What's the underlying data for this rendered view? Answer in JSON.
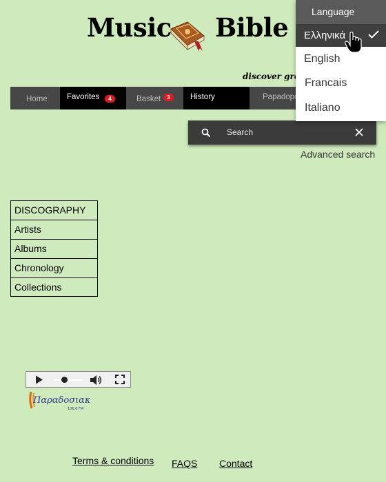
{
  "header": {
    "title_word1": "Music",
    "title_word2": "Bible",
    "tagline": "discover greek music"
  },
  "navbar": {
    "items": [
      {
        "label": "Home"
      },
      {
        "label": "Favorites",
        "badge": "4"
      },
      {
        "label": "Basket",
        "badge": "3"
      },
      {
        "label": "History"
      },
      {
        "label": "Papadopoulos"
      }
    ]
  },
  "search": {
    "placeholder": "Search",
    "advanced_label": "Advanced search"
  },
  "categories": {
    "items": [
      {
        "label": "DISCOGRAPHY"
      },
      {
        "label": "Artists"
      },
      {
        "label": "Albums"
      },
      {
        "label": "Chronology"
      },
      {
        "label": "Collections"
      }
    ]
  },
  "radio": {
    "logo_text": "Παραδοσιακός",
    "logo_freq": "106.6 FM"
  },
  "footer": {
    "links": [
      {
        "label": "Terms & conditions"
      },
      {
        "label": "FAQS"
      },
      {
        "label": "Contact"
      }
    ]
  },
  "language_menu": {
    "header": "Language",
    "selected": "Ελληνικά",
    "options": [
      {
        "label": "English"
      },
      {
        "label": "Francais"
      },
      {
        "label": "Italiano"
      }
    ]
  },
  "colors": {
    "page_bg": "#cfeabc",
    "nav_bg": "#474747",
    "badge": "#e01b24",
    "search_bg": "#3b3b3b",
    "menu_header": "#5a5a5a",
    "menu_selected": "#3f3f3f"
  },
  "icons": [
    "book-icon",
    "search-icon",
    "close-icon",
    "checkmark-icon",
    "hand-cursor-icon",
    "play-icon",
    "volume-icon",
    "fullscreen-icon"
  ]
}
